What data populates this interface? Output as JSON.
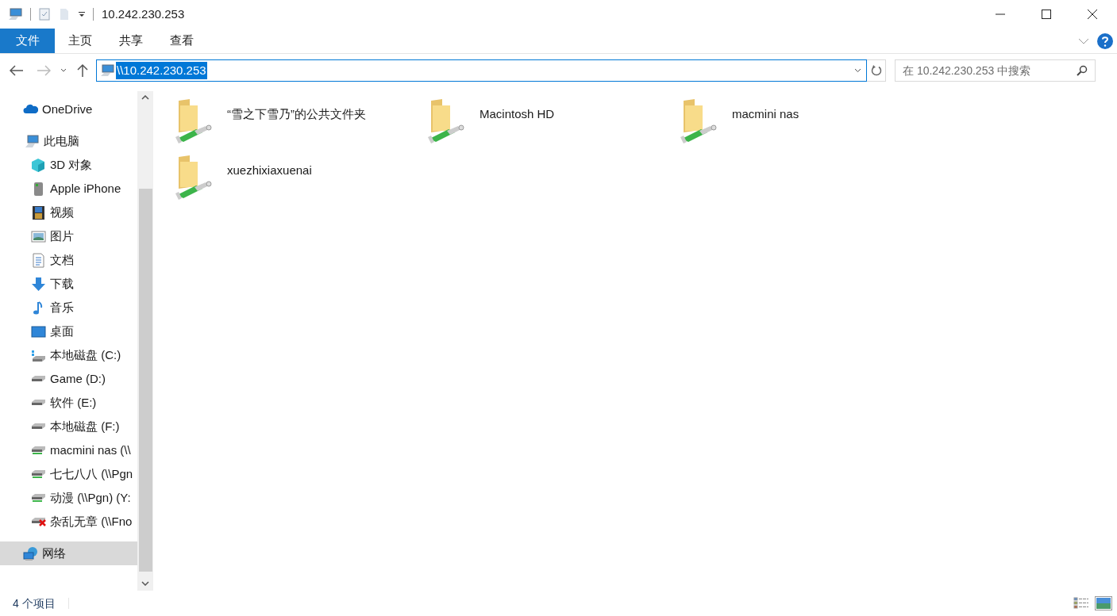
{
  "window": {
    "title": "10.242.230.253"
  },
  "ribbon_tabs": [
    {
      "label": "文件",
      "kind": "file"
    },
    {
      "label": "主页",
      "kind": "tab"
    },
    {
      "label": "共享",
      "kind": "tab"
    },
    {
      "label": "查看",
      "kind": "tab"
    }
  ],
  "address_bar": {
    "value": "\\\\10.242.230.253",
    "text_selected": true
  },
  "search": {
    "placeholder": "在 10.242.230.253 中搜索"
  },
  "navigation": [
    {
      "label": "OneDrive",
      "kind": "onedrive",
      "selected": false
    },
    {
      "label": "此电脑",
      "kind": "pc",
      "selected": false,
      "children": [
        {
          "label": "3D 对象",
          "kind": "cube",
          "selected": false
        },
        {
          "label": "Apple iPhone",
          "kind": "phone",
          "selected": false
        },
        {
          "label": "视频",
          "kind": "video",
          "selected": false
        },
        {
          "label": "图片",
          "kind": "picture",
          "selected": false
        },
        {
          "label": "文档",
          "kind": "document",
          "selected": false
        },
        {
          "label": "下载",
          "kind": "download",
          "selected": false
        },
        {
          "label": "音乐",
          "kind": "music",
          "selected": false
        },
        {
          "label": "桌面",
          "kind": "desktop",
          "selected": false
        },
        {
          "label": "本地磁盘 (C:)",
          "kind": "system_drive",
          "selected": false
        },
        {
          "label": "Game (D:)",
          "kind": "drive",
          "selected": false
        },
        {
          "label": "软件 (E:)",
          "kind": "drive",
          "selected": false
        },
        {
          "label": "本地磁盘 (F:)",
          "kind": "drive",
          "selected": false
        },
        {
          "label": "macmini nas (\\\\",
          "kind": "network_drive",
          "selected": false
        },
        {
          "label": "七七八八 (\\\\Pgn",
          "kind": "network_drive",
          "selected": false
        },
        {
          "label": "动漫 (\\\\Pgn) (Y:",
          "kind": "network_drive",
          "selected": false
        },
        {
          "label": "杂乱无章 (\\\\Fno",
          "kind": "disconnected_drive",
          "selected": false
        }
      ]
    },
    {
      "label": "网络",
      "kind": "network",
      "selected": true
    }
  ],
  "shares": [
    {
      "name": "“雪之下雪乃”的公共文件夹"
    },
    {
      "name": "Macintosh HD"
    },
    {
      "name": "macmini nas"
    },
    {
      "name": "xuezhixiaxuenai"
    }
  ],
  "status_bar": {
    "item_count": "4 个项目"
  }
}
